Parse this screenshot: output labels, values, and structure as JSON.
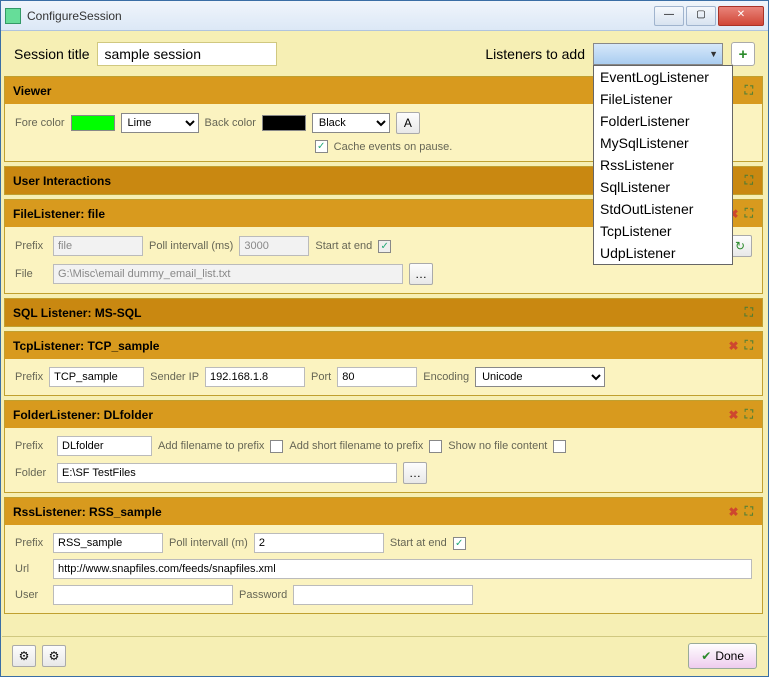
{
  "window": {
    "title": "ConfigureSession"
  },
  "top": {
    "session_title_label": "Session title",
    "session_title_value": "sample session",
    "listeners_label": "Listeners to add",
    "dropdown_selected": "",
    "dropdown_items": [
      "EventLogListener",
      "FileListener",
      "FolderListener",
      "MySqlListener",
      "RssListener",
      "SqlListener",
      "StdOutListener",
      "TcpListener",
      "UdpListener"
    ]
  },
  "viewer": {
    "header": "Viewer",
    "fore_label": "Fore color",
    "fore_value": "Lime",
    "fore_color": "#00ff00",
    "back_label": "Back color",
    "back_value": "Black",
    "back_color": "#000000",
    "cache_label": "Cache events on pause."
  },
  "userint": {
    "header": "User Interactions"
  },
  "file": {
    "header": "FileListener: file",
    "prefix_label": "Prefix",
    "prefix_value": "file",
    "poll_label": "Poll intervall (ms)",
    "poll_value": "3000",
    "start_label": "Start at end",
    "file_label": "File",
    "file_value": "G:\\Misc\\email dummy_email_list.txt"
  },
  "sql": {
    "header": "SQL Listener: MS-SQL"
  },
  "tcp": {
    "header": "TcpListener: TCP_sample",
    "prefix_label": "Prefix",
    "prefix_value": "TCP_sample",
    "sender_label": "Sender IP",
    "sender_value": "192.168.1.8",
    "port_label": "Port",
    "port_value": "80",
    "encoding_label": "Encoding",
    "encoding_value": "Unicode"
  },
  "folder": {
    "header": "FolderListener: DLfolder",
    "prefix_label": "Prefix",
    "prefix_value": "DLfolder",
    "addfn_label": "Add filename to prefix",
    "addshort_label": "Add short filename to prefix",
    "shownone_label": "Show no file content",
    "folder_label": "Folder",
    "folder_value": "E:\\SF TestFiles"
  },
  "rss": {
    "header": "RssListener: RSS_sample",
    "prefix_label": "Prefix",
    "prefix_value": "RSS_sample",
    "poll_label": "Poll intervall (m)",
    "poll_value": "2",
    "start_label": "Start at end",
    "url_label": "Url",
    "url_value": "http://www.snapfiles.com/feeds/snapfiles.xml",
    "user_label": "User",
    "user_value": "",
    "pass_label": "Password",
    "pass_value": ""
  },
  "bottom": {
    "done": "Done"
  }
}
